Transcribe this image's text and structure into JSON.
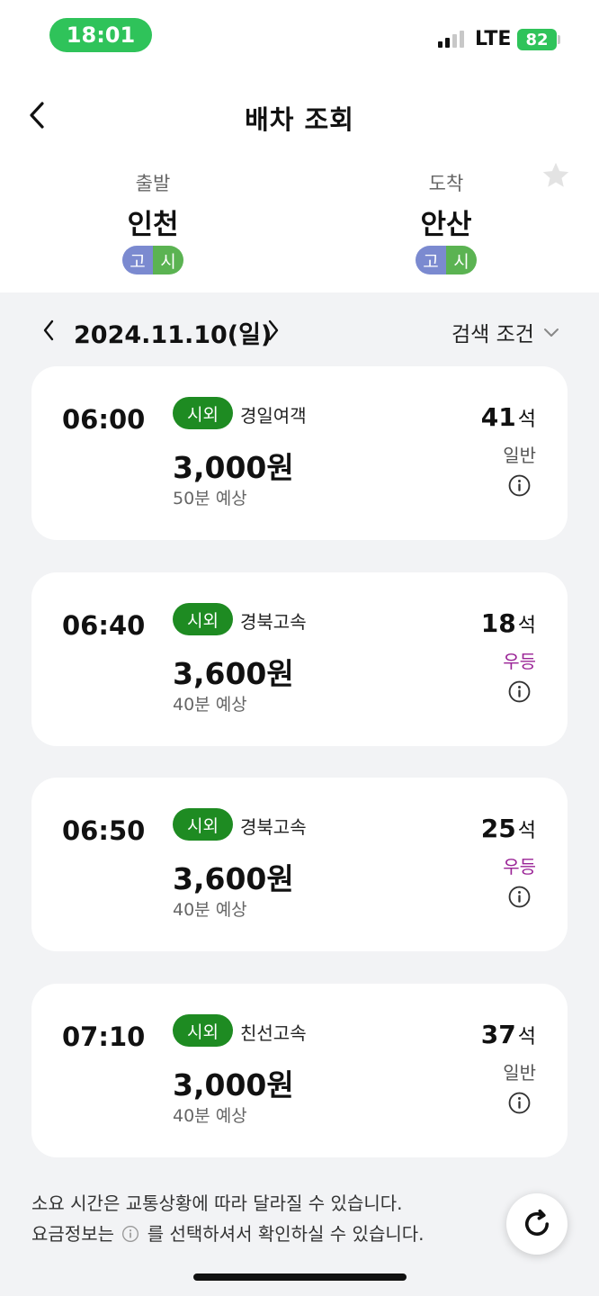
{
  "status_bar": {
    "time": "18:01",
    "network": "LTE",
    "battery": "82"
  },
  "header": {
    "title": "배차 조회"
  },
  "route": {
    "departure": {
      "label": "출발",
      "city": "인천",
      "badges": [
        "고",
        "시"
      ]
    },
    "arrival": {
      "label": "도착",
      "city": "안산",
      "badges": [
        "고",
        "시"
      ]
    }
  },
  "date_bar": {
    "date": "2024.11.10(일)",
    "filter_label": "검색 조건"
  },
  "buses": [
    {
      "time": "06:00",
      "type": "시외",
      "company": "경일여객",
      "fare": "3,000원",
      "duration": "50분 예상",
      "seats": "41",
      "seat_unit": "석",
      "grade": "일반",
      "grade_color": "#555555"
    },
    {
      "time": "06:40",
      "type": "시외",
      "company": "경북고속",
      "fare": "3,600원",
      "duration": "40분 예상",
      "seats": "18",
      "seat_unit": "석",
      "grade": "우등",
      "grade_color": "#9a2396"
    },
    {
      "time": "06:50",
      "type": "시외",
      "company": "경북고속",
      "fare": "3,600원",
      "duration": "40분 예상",
      "seats": "25",
      "seat_unit": "석",
      "grade": "우등",
      "grade_color": "#9a2396"
    },
    {
      "time": "07:10",
      "type": "시외",
      "company": "친선고속",
      "fare": "3,000원",
      "duration": "40분 예상",
      "seats": "37",
      "seat_unit": "석",
      "grade": "일반",
      "grade_color": "#555555"
    }
  ],
  "footer": {
    "note_line1": "소요 시간은 교통상황에 따라 달라질 수 있습니다.",
    "note_line2_before": "요금정보는",
    "note_line2_after": "를 선택하셔서 확인하실 수 있습니다."
  },
  "colors": {
    "accent_green": "#2fc35a",
    "bus_type_green": "#1e8b22",
    "premium_purple": "#9a2396",
    "badge_blue": "#7b8ad0",
    "badge_green": "#5bb352"
  },
  "icons": [
    "back-chevron-icon",
    "star-icon",
    "chevron-left-icon",
    "chevron-right-icon",
    "chevron-down-icon",
    "info-icon",
    "refresh-icon"
  ]
}
